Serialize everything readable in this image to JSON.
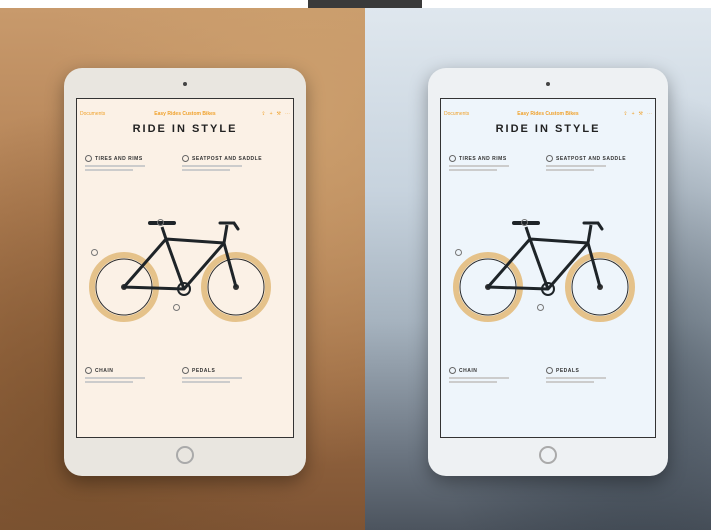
{
  "devices": [
    {
      "side": "left",
      "tone": "warm",
      "screen_bg": "#fbf1e6",
      "nav": {
        "back": "Documents",
        "title": "Easy Rides Custom Bikes",
        "icons": [
          "share-icon",
          "add-icon",
          "wrench-icon",
          "more-icon"
        ]
      },
      "heading": "RIDE IN STYLE",
      "sections": [
        {
          "title": "TIRES AND RIMS"
        },
        {
          "title": "SEATPOST AND SADDLE"
        },
        {
          "title": "CHAIN"
        },
        {
          "title": "PEDALS"
        }
      ]
    },
    {
      "side": "right",
      "tone": "cool",
      "screen_bg": "#eef5fb",
      "nav": {
        "back": "Documents",
        "title": "Easy Rides Custom Bikes",
        "icons": [
          "share-icon",
          "add-icon",
          "wrench-icon",
          "more-icon"
        ]
      },
      "heading": "RIDE IN STYLE",
      "sections": [
        {
          "title": "TIRES AND RIMS"
        },
        {
          "title": "SEATPOST AND SADDLE"
        },
        {
          "title": "CHAIN"
        },
        {
          "title": "PEDALS"
        }
      ]
    }
  ],
  "colors": {
    "accent": "#f0a12a",
    "tire": "#e5c28a",
    "frame": "#1e2428"
  }
}
